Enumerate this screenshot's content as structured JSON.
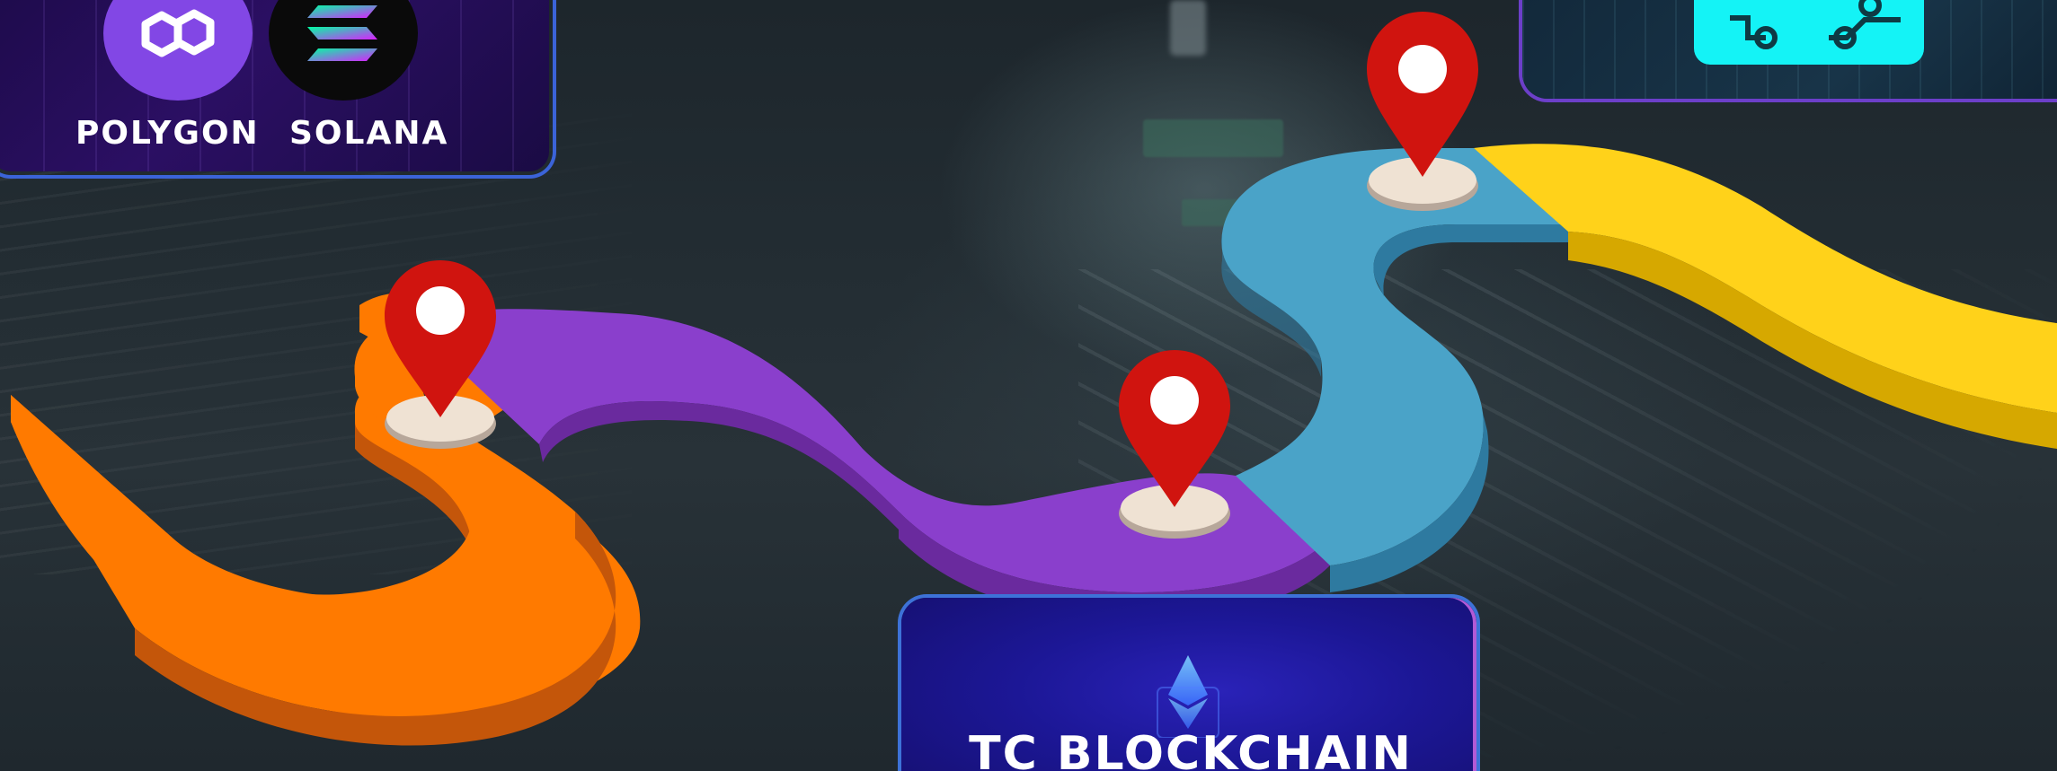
{
  "chains_card": {
    "items": [
      {
        "label": "POLYGON",
        "icon": "polygon-logo-icon",
        "color": "#8247e5"
      },
      {
        "label": "SOLANA",
        "icon": "solana-logo-icon",
        "color": "#0a0a0a"
      }
    ]
  },
  "tech_card": {
    "icon": "circuit-chip-icon",
    "color": "#14f3f6"
  },
  "bottom_card": {
    "title": "TC BLOCKCHAIN",
    "icon": "ethereum-icon"
  },
  "road": {
    "segments": [
      {
        "color": "#ff7a00"
      },
      {
        "color": "#8a3fcc"
      },
      {
        "color": "#4aa3c8"
      },
      {
        "color": "#ffd21a"
      }
    ]
  },
  "pins": [
    {
      "icon": "map-pin-icon",
      "color": "#d0140f"
    },
    {
      "icon": "map-pin-icon",
      "color": "#d0140f"
    },
    {
      "icon": "map-pin-icon",
      "color": "#d0140f"
    }
  ]
}
